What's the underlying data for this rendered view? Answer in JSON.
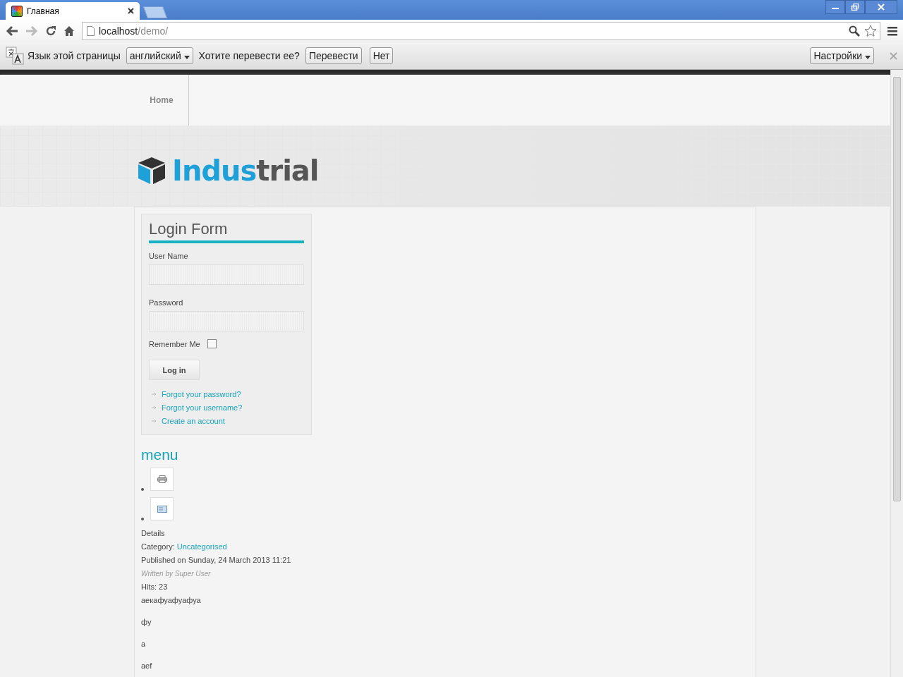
{
  "browser": {
    "tab_title": "Главная",
    "url_host": "localhost",
    "url_path": "/demo/"
  },
  "translate_bar": {
    "label": "Язык этой страницы",
    "language": "английский",
    "question": "Хотите перевести ее?",
    "translate_button": "Перевести",
    "no_button": "Нет",
    "settings_button": "Настройки"
  },
  "site_nav": [
    {
      "label": "Home"
    }
  ],
  "logo": {
    "lead": "Indus",
    "rest": "trial"
  },
  "login_form": {
    "title": "Login Form",
    "username_label": "User Name",
    "password_label": "Password",
    "remember_label": "Remember Me",
    "remember_checked": false,
    "submit": "Log in",
    "links": [
      "Forgot your password?",
      "Forgot your username?",
      "Create an account"
    ]
  },
  "menu": {
    "title": "menu",
    "items": [
      {
        "kind": "print"
      },
      {
        "kind": "email"
      }
    ]
  },
  "article": {
    "details": "Details",
    "category_label": "Category:",
    "category": "Uncategorised",
    "published": "Published on Sunday, 24 March 2013 11:21",
    "author": "Written by Super User",
    "hits": "Hits: 23",
    "paragraphs": [
      "аекафуафуафуа",
      "фу",
      "а",
      "aef"
    ]
  }
}
